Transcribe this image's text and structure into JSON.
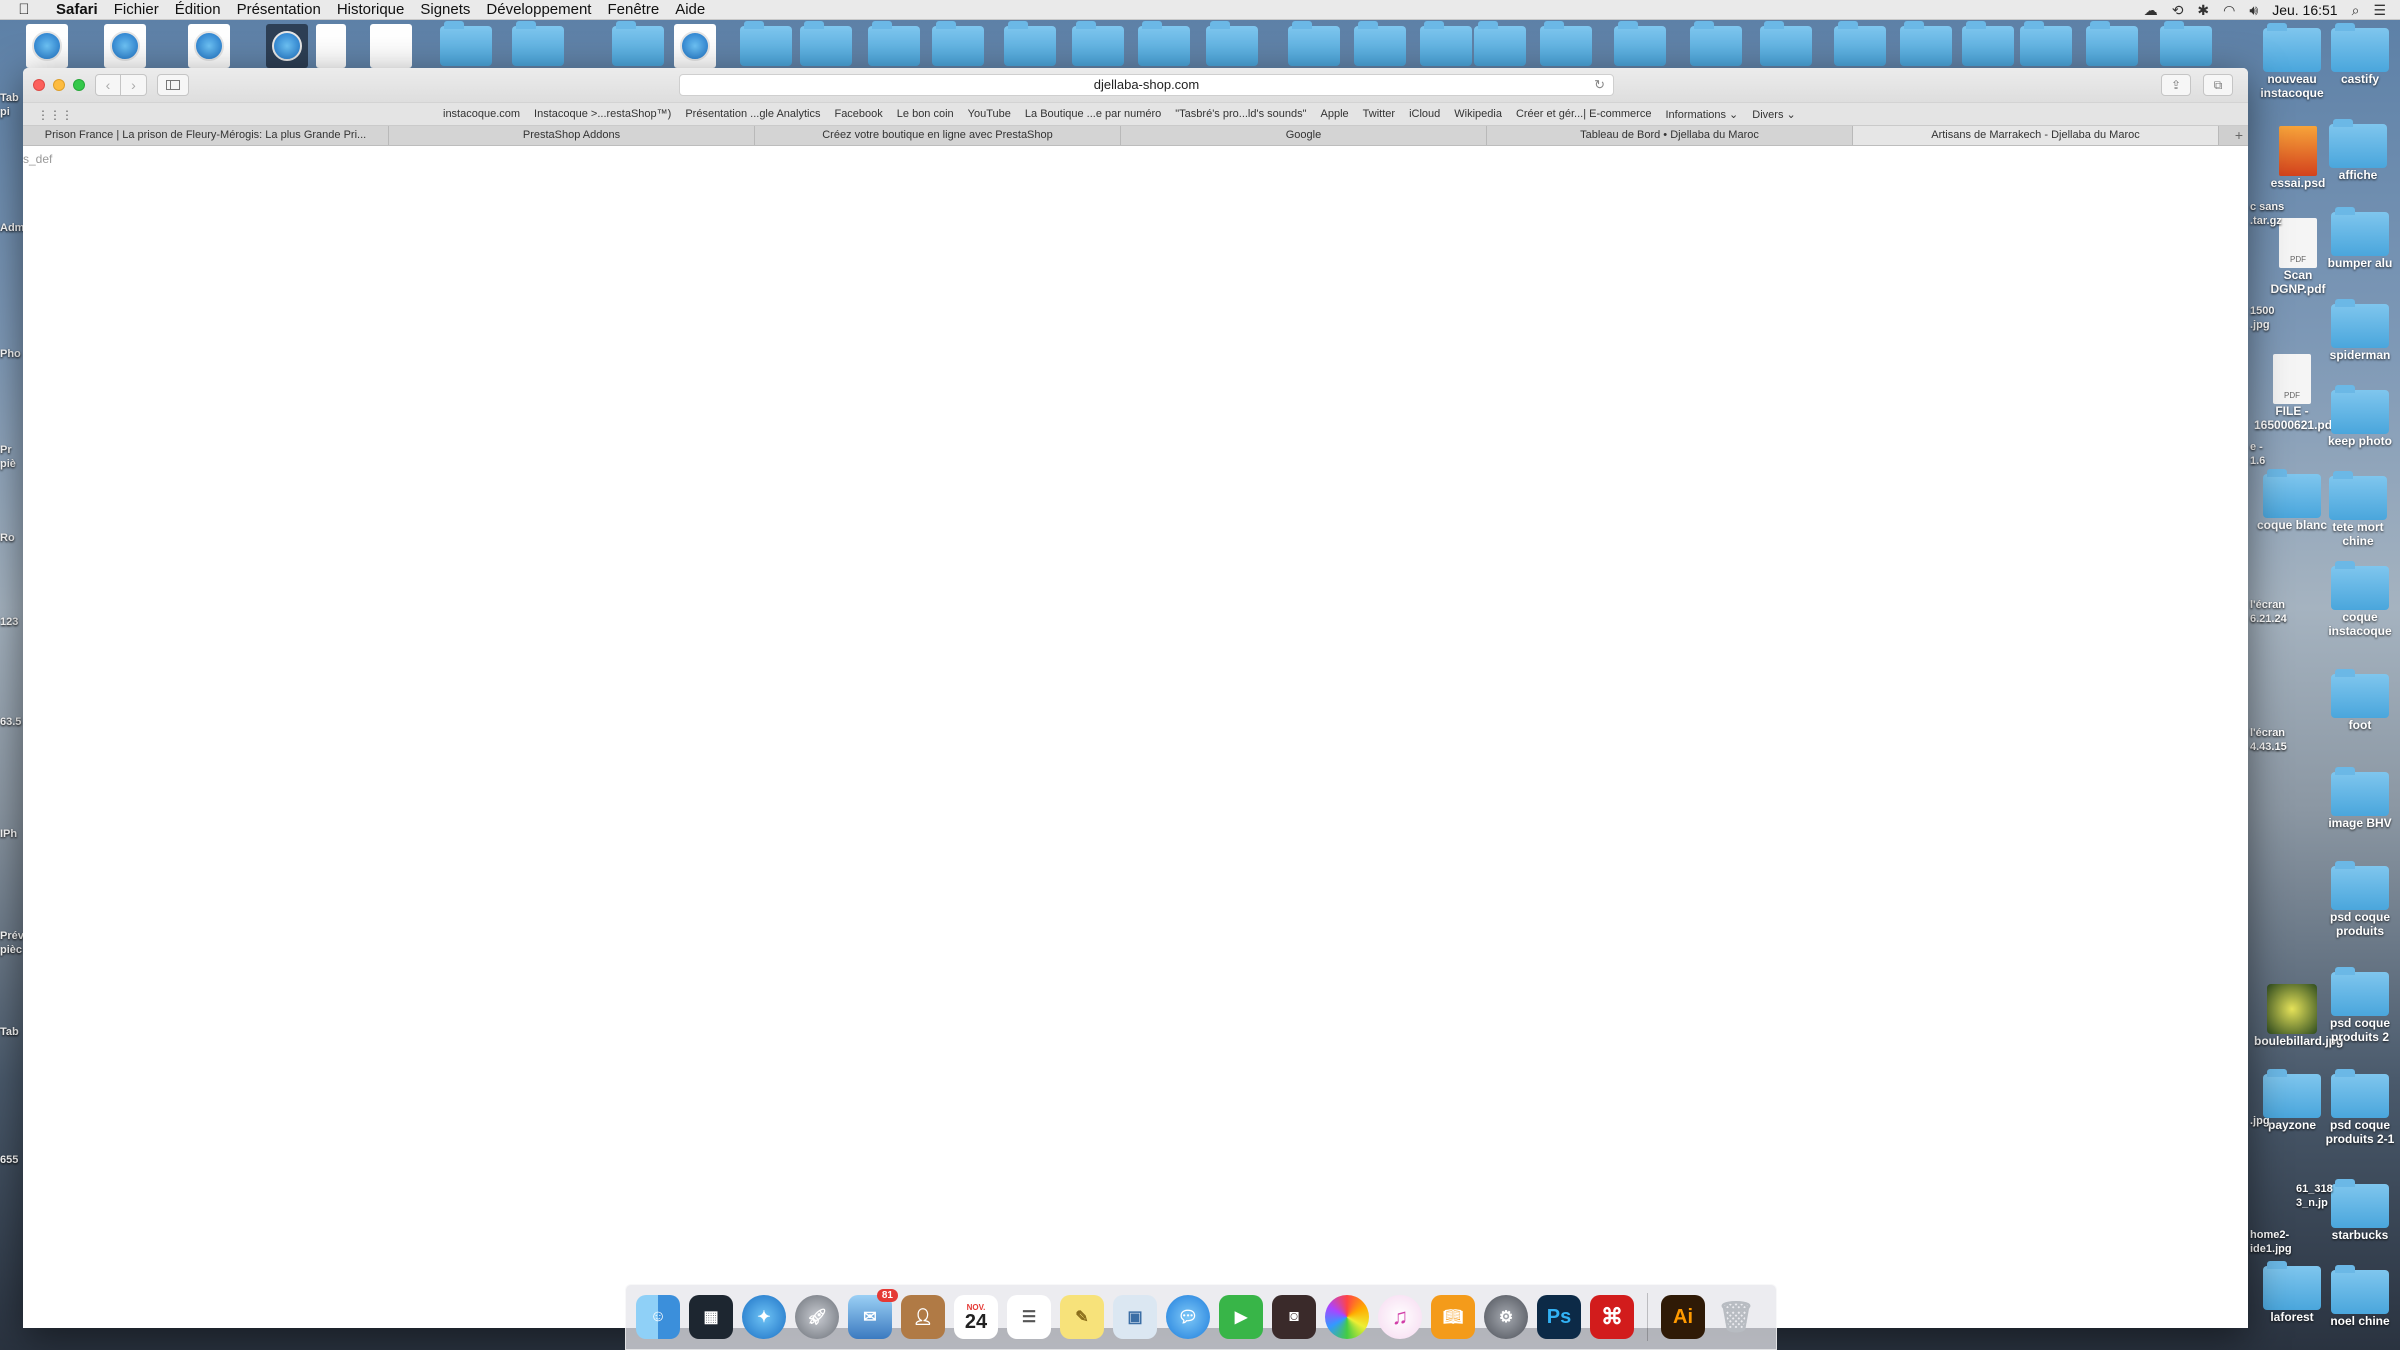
{
  "menubar": {
    "app": "Safari",
    "items": [
      "Fichier",
      "Édition",
      "Présentation",
      "Historique",
      "Signets",
      "Développement",
      "Fenêtre",
      "Aide"
    ],
    "clock": "Jeu. 16:51"
  },
  "browser": {
    "url": "djellaba-shop.com",
    "favorites": [
      "instacoque.com",
      "Instacoque >...restaShop™)",
      "Présentation ...gle Analytics",
      "Facebook",
      "Le bon coin",
      "YouTube",
      "La Boutique ...e par numéro",
      "\"Tasbré's pro...ld's sounds\"",
      "Apple",
      "Twitter",
      "iCloud",
      "Wikipedia",
      "Créer et gér...| E-commerce",
      "Informations ⌄",
      "Divers ⌄"
    ],
    "tabs": [
      "Prison France | La prison de Fleury-Mérogis: La plus Grande Pri...",
      "PrestaShop Addons",
      "Créez votre boutique en ligne avec PrestaShop",
      "Google",
      "Tableau de Bord • Djellaba du Maroc",
      "Artisans de Marrakech - Djellaba du Maroc"
    ],
    "active_tab": 5,
    "content_snippet": "s_def"
  },
  "desktop_right": [
    {
      "label": "nouveau instacoque",
      "type": "folder"
    },
    {
      "label": "castify",
      "type": "folder"
    },
    {
      "label": "essai.psd",
      "type": "doc"
    },
    {
      "label": "affiche",
      "type": "folder"
    },
    {
      "label": "Scan DGNP.pdf",
      "type": "pdf"
    },
    {
      "label": "bumper alu",
      "type": "folder"
    },
    {
      "label": "spiderman",
      "type": "folder"
    },
    {
      "label": "FILE - 165000621.pdf",
      "type": "pdf"
    },
    {
      "label": "keep photo",
      "type": "folder"
    },
    {
      "label": "coque blanc",
      "type": "folder"
    },
    {
      "label": "tete mort chine",
      "type": "folder"
    },
    {
      "label": "coque instacoque",
      "type": "folder"
    },
    {
      "label": "foot",
      "type": "folder"
    },
    {
      "label": "image BHV",
      "type": "folder"
    },
    {
      "label": "psd coque produits",
      "type": "folder"
    },
    {
      "label": "boulebillard.jpg",
      "type": "doc"
    },
    {
      "label": "psd coque produits 2",
      "type": "folder"
    },
    {
      "label": "payzone",
      "type": "folder"
    },
    {
      "label": "psd coque produits 2-1",
      "type": "folder"
    },
    {
      "label": "starbucks",
      "type": "folder"
    },
    {
      "label": "laforest",
      "type": "folder"
    },
    {
      "label": "noel chine",
      "type": "folder"
    }
  ],
  "desktop_partial": [
    "c sans",
    ".tar.gz",
    "1500",
    ".jpg",
    "e -",
    "1.6",
    "l'écran",
    "6.21.24",
    "l'écran",
    "4.43.15",
    ".jpg",
    "61_318",
    "3_n.jp",
    "home2-",
    "ide1.jpg"
  ],
  "desktop_left": [
    "Tab",
    "pi",
    "Adm",
    "Pho",
    "Pr",
    "piè",
    "Ro",
    "123",
    "63.5",
    "IPh",
    "Prév",
    "pièc",
    "Tab",
    "655"
  ],
  "dock": {
    "apps": [
      "Finder",
      "Mission Control",
      "Safari",
      "Launchpad",
      "Mail",
      "Contacts",
      "Calendar",
      "Reminders",
      "Notes",
      "Preview",
      "Messages",
      "FaceTime",
      "Photo Booth",
      "Photos",
      "iTunes",
      "iBooks",
      "System Preferences",
      "Photoshop",
      "Acrobat",
      "Illustrator",
      "Trash"
    ],
    "mail_badge": "81",
    "calendar_day": "24",
    "calendar_month": "NOV.",
    "ps_label": "Ps",
    "ai_label": "Ai"
  }
}
